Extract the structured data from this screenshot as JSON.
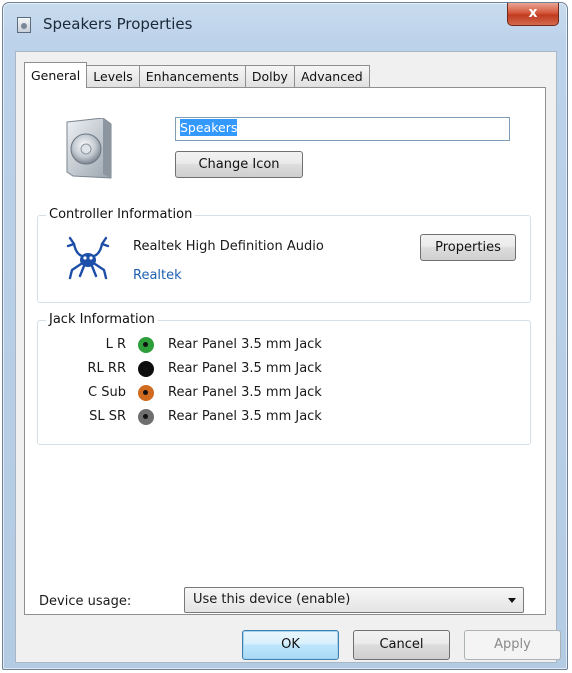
{
  "window": {
    "title": "Speakers Properties",
    "close_glyph": "x"
  },
  "tabs": [
    {
      "label": "General",
      "active": true
    },
    {
      "label": "Levels",
      "active": false
    },
    {
      "label": "Enhancements",
      "active": false
    },
    {
      "label": "Dolby",
      "active": false
    },
    {
      "label": "Advanced",
      "active": false
    }
  ],
  "general": {
    "device_icon": "speaker-icon",
    "device_name": "Speakers",
    "change_icon_label": "Change Icon"
  },
  "controller": {
    "group_label": "Controller Information",
    "icon": "realtek-crab-icon",
    "name": "Realtek High Definition Audio",
    "vendor": "Realtek",
    "properties_label": "Properties"
  },
  "jacks": {
    "group_label": "Jack Information",
    "rows": [
      {
        "channels": "L R",
        "color": "#2e9e3a",
        "description": "Rear Panel 3.5 mm Jack"
      },
      {
        "channels": "RL RR",
        "color": "#0d0d0d",
        "description": "Rear Panel 3.5 mm Jack"
      },
      {
        "channels": "C Sub",
        "color": "#d06a1e",
        "description": "Rear Panel 3.5 mm Jack"
      },
      {
        "channels": "SL SR",
        "color": "#6f6f6f",
        "description": "Rear Panel 3.5 mm Jack"
      }
    ]
  },
  "usage": {
    "label": "Device usage:",
    "selected": "Use this device (enable)"
  },
  "buttons": {
    "ok": "OK",
    "cancel": "Cancel",
    "apply": "Apply"
  }
}
